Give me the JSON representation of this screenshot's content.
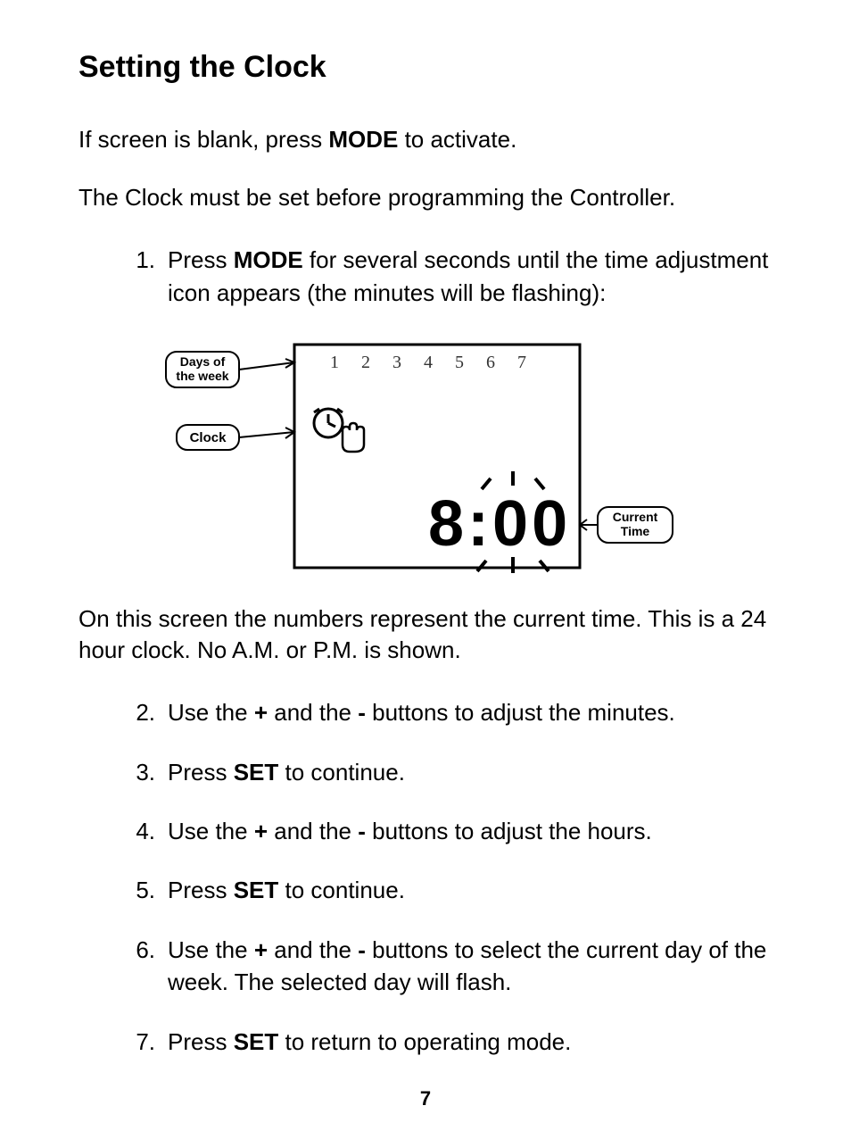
{
  "title": "Setting the Clock",
  "intro1_pre": "If screen is blank, press ",
  "intro1_bold": "MODE",
  "intro1_post": " to activate.",
  "intro2": "The Clock must be set before programming the Controller.",
  "step1_num": "1.",
  "step1_pre": "Press ",
  "step1_bold": "MODE",
  "step1_post": " for several seconds until the time adjustment icon appears (the minutes will be flashing):",
  "diagram": {
    "label_days_l1": "Days of",
    "label_days_l2": "the week",
    "label_clock": "Clock",
    "label_current_l1": "Current",
    "label_current_l2": "Time",
    "days": [
      "1",
      "2",
      "3",
      "4",
      "5",
      "6",
      "7"
    ],
    "time": "8:00"
  },
  "mid_para": "On this screen the numbers represent the current time. This is a 24 hour clock. No A.M. or P.M. is shown.",
  "step2_num": "2.",
  "step2_a": "Use the ",
  "step2_plus": "+",
  "step2_b": " and the ",
  "step2_minus": "-",
  "step2_c": " buttons to adjust the minutes.",
  "step3_num": "3.",
  "step3_a": "Press ",
  "step3_bold": "SET",
  "step3_b": " to continue.",
  "step4_num": "4.",
  "step4_a": "Use the ",
  "step4_plus": "+",
  "step4_b": " and the ",
  "step4_minus": "-",
  "step4_c": " buttons to adjust the hours.",
  "step5_num": "5.",
  "step5_a": "Press ",
  "step5_bold": "SET",
  "step5_b": " to continue.",
  "step6_num": "6.",
  "step6_a": "Use the ",
  "step6_plus": "+",
  "step6_b": " and the ",
  "step6_minus": "-",
  "step6_c": " buttons to select the current day of the week. The selected day will flash.",
  "step7_num": "7.",
  "step7_a": "Press ",
  "step7_bold": "SET",
  "step7_b": " to return to operating mode.",
  "page_number": "7"
}
